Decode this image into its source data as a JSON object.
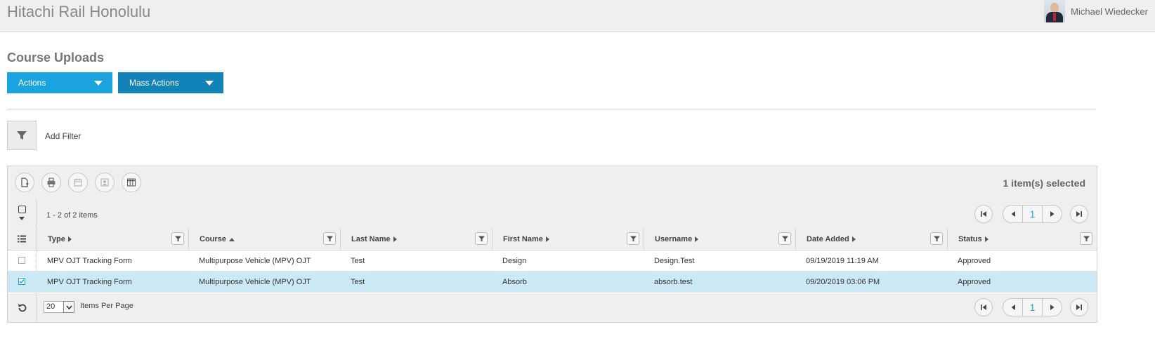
{
  "app": {
    "title": "Hitachi Rail Honolulu",
    "user_name": "Michael Wiedecker"
  },
  "page": {
    "title": "Course Uploads"
  },
  "buttons": {
    "actions": "Actions",
    "mass_actions": "Mass Actions"
  },
  "filter": {
    "add_label": "Add Filter"
  },
  "toolbar": {
    "selected_text": "1 item(s) selected"
  },
  "pager": {
    "item_count": "1 - 2 of 2 items",
    "current_page": "1"
  },
  "columns": [
    {
      "label": "Type",
      "sort": "none"
    },
    {
      "label": "Course",
      "sort": "asc"
    },
    {
      "label": "Last Name",
      "sort": "none"
    },
    {
      "label": "First Name",
      "sort": "none"
    },
    {
      "label": "Username",
      "sort": "none"
    },
    {
      "label": "Date Added",
      "sort": "none"
    },
    {
      "label": "Status",
      "sort": "none"
    }
  ],
  "rows": [
    {
      "selected": false,
      "cells": [
        "MPV OJT Tracking Form",
        "Multipurpose Vehicle (MPV) OJT",
        "Test",
        "Design",
        "Design.Test",
        "09/19/2019 11:19 AM",
        "Approved"
      ]
    },
    {
      "selected": true,
      "cells": [
        "MPV OJT Tracking Form",
        "Multipurpose Vehicle (MPV) OJT",
        "Test",
        "Absorb",
        "absorb.test",
        "09/20/2019 03:06 PM",
        "Approved"
      ]
    }
  ],
  "footer": {
    "per_page_value": "20",
    "per_page_label": "Items Per Page"
  },
  "colors": {
    "primary": "#1aa3de",
    "primary_dark": "#1283b8",
    "selected_row": "#cbe9f5"
  }
}
